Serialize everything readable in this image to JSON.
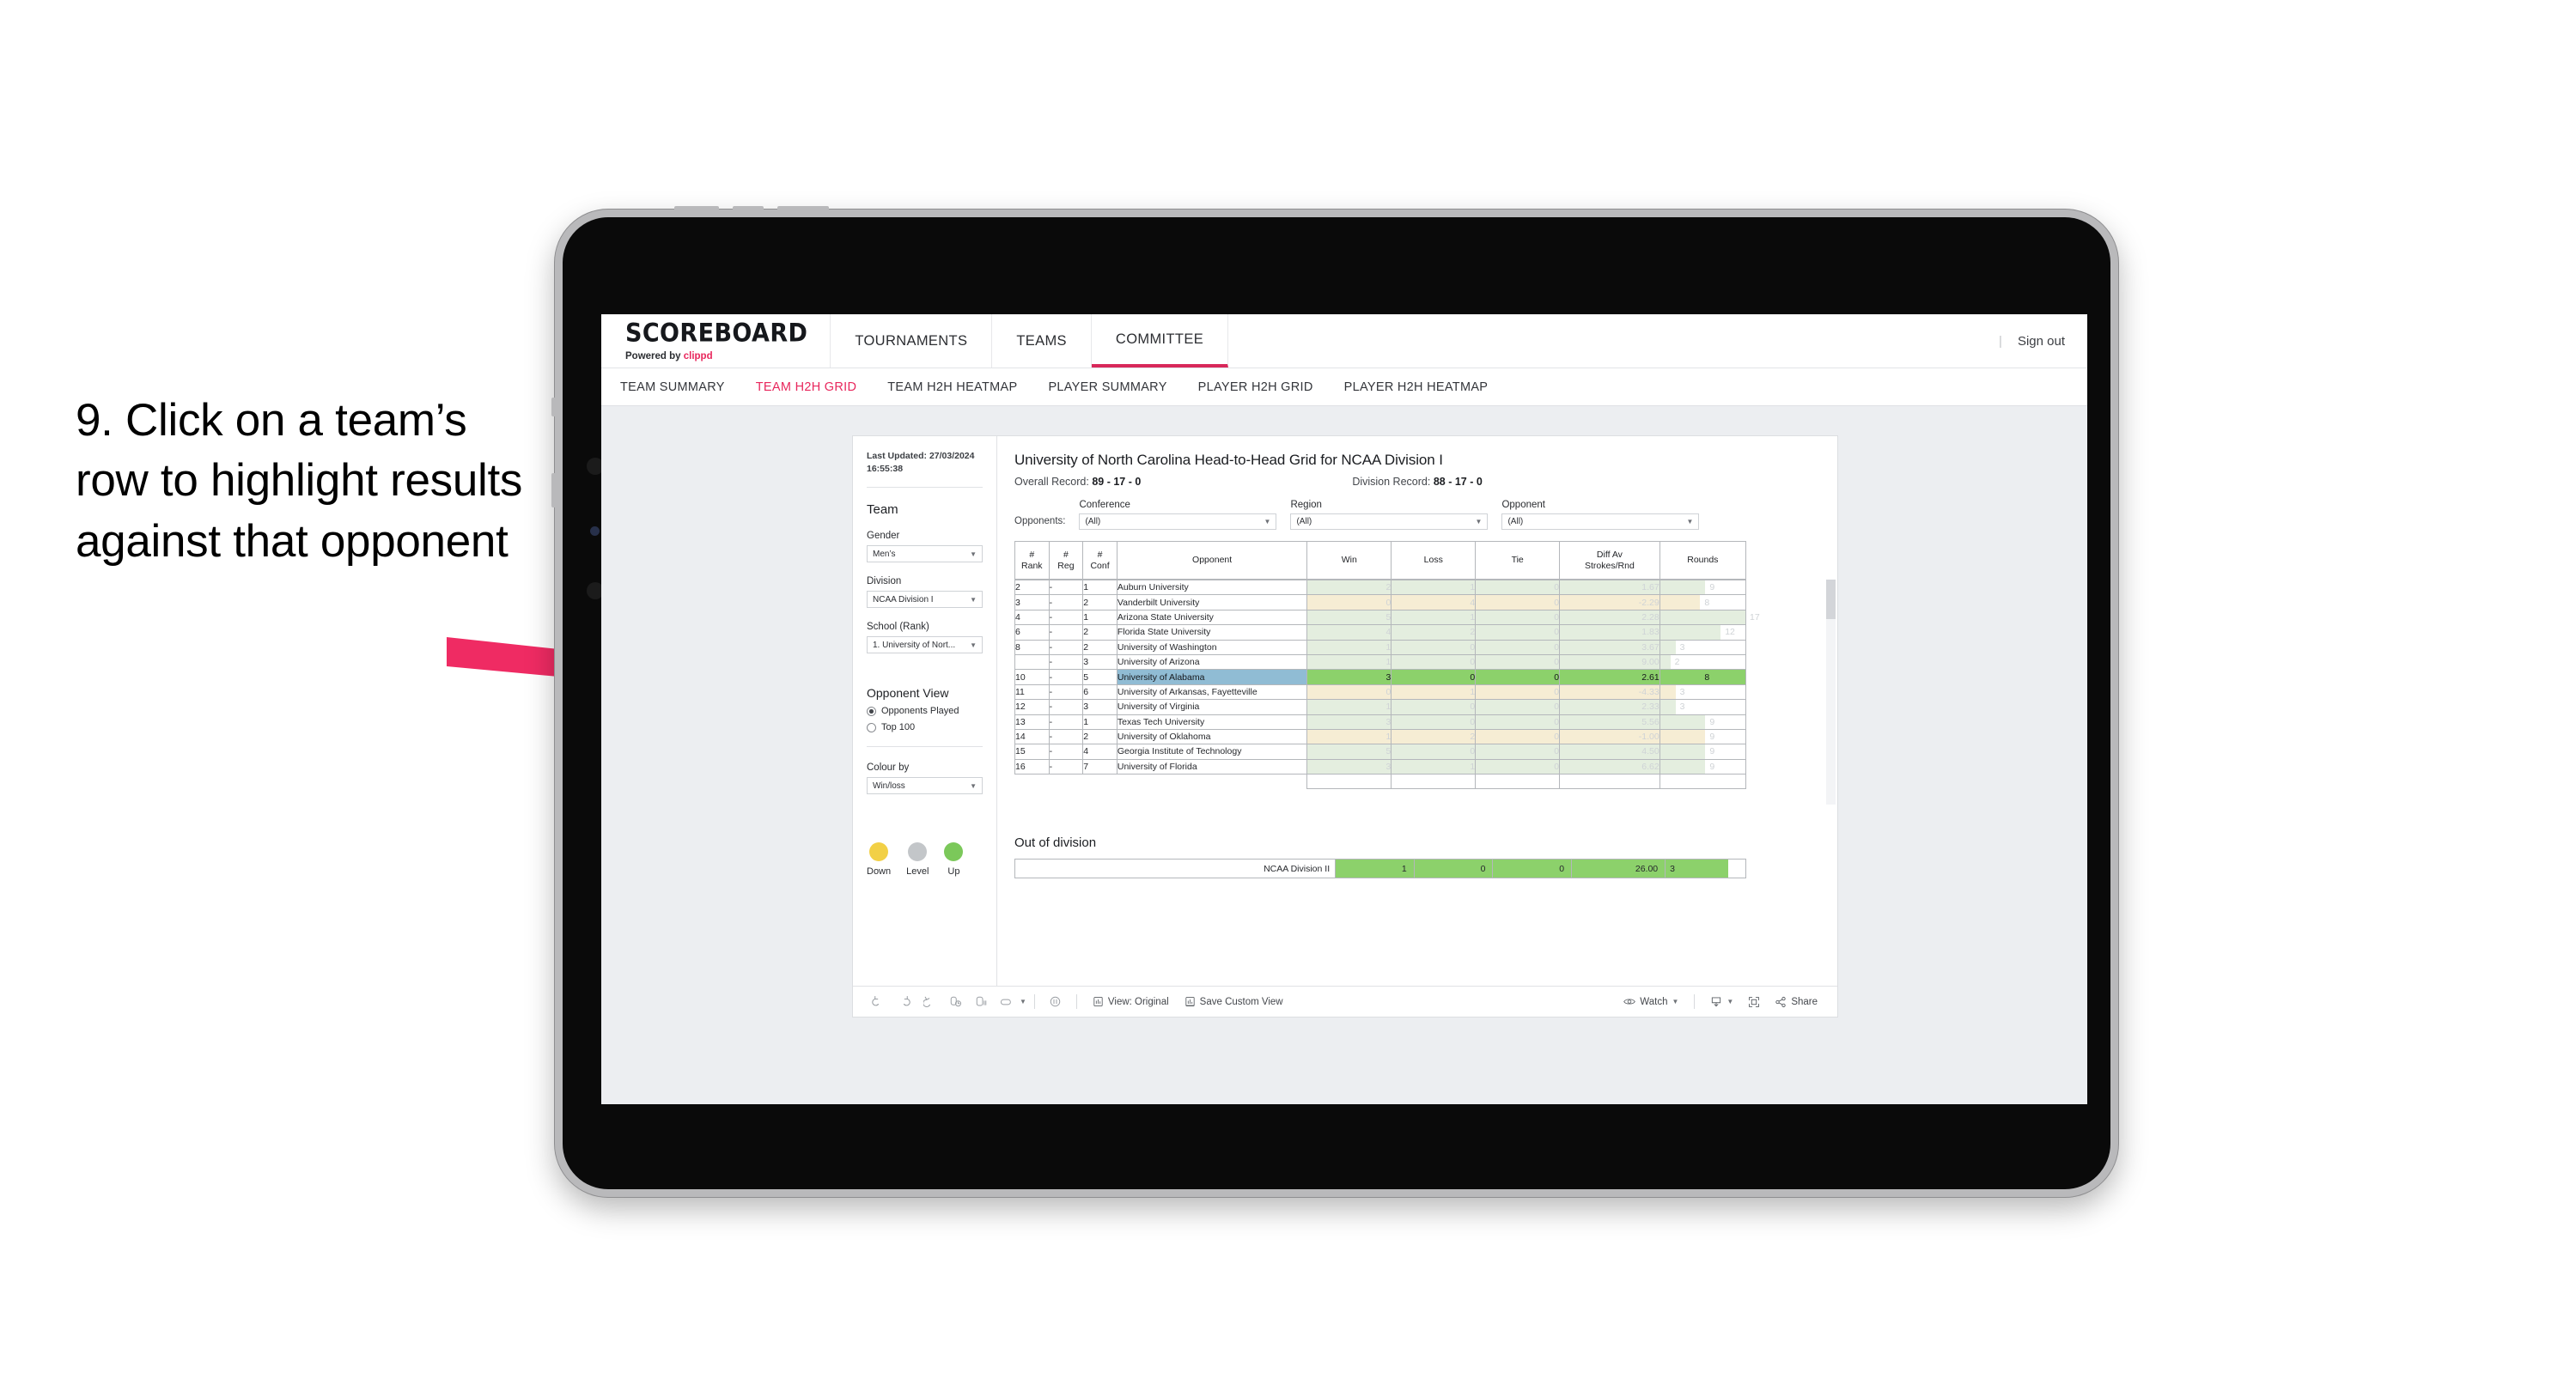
{
  "caption": "9. Click on a team’s row to highlight results against that opponent",
  "topnav": {
    "brand_title": "SCOREBOARD",
    "brand_sub_prefix": "Powered by ",
    "brand_sub_name": "clippd",
    "tabs": [
      {
        "label": "TOURNAMENTS",
        "active": false
      },
      {
        "label": "TEAMS",
        "active": false
      },
      {
        "label": "COMMITTEE",
        "active": true
      }
    ],
    "separator": "|",
    "signout": "Sign out"
  },
  "subnav": {
    "tabs": [
      {
        "label": "TEAM SUMMARY",
        "active": false
      },
      {
        "label": "TEAM H2H GRID",
        "active": true
      },
      {
        "label": "TEAM H2H HEATMAP",
        "active": false
      },
      {
        "label": "PLAYER SUMMARY",
        "active": false
      },
      {
        "label": "PLAYER H2H GRID",
        "active": false
      },
      {
        "label": "PLAYER H2H HEATMAP",
        "active": false
      }
    ]
  },
  "sidebar": {
    "last_updated_label": "Last Updated:",
    "last_updated_value": "27/03/2024 16:55:38",
    "team_heading": "Team",
    "gender_label": "Gender",
    "gender_value": "Men’s",
    "division_label": "Division",
    "division_value": "NCAA Division I",
    "school_label": "School (Rank)",
    "school_value": "1. University of Nort...",
    "opponent_view_heading": "Opponent View",
    "opponent_view_options": [
      {
        "label": "Opponents Played",
        "selected": true
      },
      {
        "label": "Top 100",
        "selected": false
      }
    ],
    "colour_by_label": "Colour by",
    "colour_by_value": "Win/loss",
    "legend": [
      {
        "label": "Down",
        "color": "#f2d046"
      },
      {
        "label": "Level",
        "color": "#c3c6c9"
      },
      {
        "label": "Up",
        "color": "#7bc85a"
      }
    ]
  },
  "main": {
    "title": "University of North Carolina Head-to-Head Grid for NCAA Division I",
    "overall_record_label": "Overall Record:",
    "overall_record_value": "89 - 17 - 0",
    "division_record_label": "Division Record:",
    "division_record_value": "88 - 17 - 0",
    "opponents_label": "Opponents:",
    "filters": [
      {
        "label": "Conference",
        "value": "(All)"
      },
      {
        "label": "Region",
        "value": "(All)"
      },
      {
        "label": "Opponent",
        "value": "(All)"
      }
    ],
    "columns": [
      "# Rank",
      "# Reg",
      "# Conf",
      "Opponent",
      "Win",
      "Loss",
      "Tie",
      "Diff Av Strokes/Rnd",
      "Rounds"
    ],
    "columns_split": [
      {
        "l1": "#",
        "l2": "Rank"
      },
      {
        "l1": "#",
        "l2": "Reg"
      },
      {
        "l1": "#",
        "l2": "Conf"
      },
      {
        "l1": "",
        "l2": "Opponent"
      },
      {
        "l1": "",
        "l2": "Win"
      },
      {
        "l1": "",
        "l2": "Loss"
      },
      {
        "l1": "",
        "l2": "Tie"
      },
      {
        "l1": "Diff Av",
        "l2": "Strokes/Rnd"
      },
      {
        "l1": "",
        "l2": "Rounds"
      }
    ],
    "rows": [
      {
        "rank": "2",
        "reg": "-",
        "conf": "1",
        "opponent": "Auburn University",
        "win": "2",
        "loss": "1",
        "tie": "0",
        "diff": "1.67",
        "rounds": "9",
        "tone": "up",
        "selected": false
      },
      {
        "rank": "3",
        "reg": "-",
        "conf": "2",
        "opponent": "Vanderbilt University",
        "win": "0",
        "loss": "4",
        "tie": "0",
        "diff": "-2.29",
        "rounds": "8",
        "tone": "down",
        "selected": false
      },
      {
        "rank": "4",
        "reg": "-",
        "conf": "1",
        "opponent": "Arizona State University",
        "win": "5",
        "loss": "1",
        "tie": "0",
        "diff": "2.28",
        "rounds": "17",
        "tone": "up",
        "selected": false
      },
      {
        "rank": "6",
        "reg": "-",
        "conf": "2",
        "opponent": "Florida State University",
        "win": "4",
        "loss": "2",
        "tie": "0",
        "diff": "1.83",
        "rounds": "12",
        "tone": "up",
        "selected": false
      },
      {
        "rank": "8",
        "reg": "-",
        "conf": "2",
        "opponent": "University of Washington",
        "win": "1",
        "loss": "0",
        "tie": "0",
        "diff": "3.67",
        "rounds": "3",
        "tone": "up",
        "selected": false
      },
      {
        "rank": "",
        "reg": "-",
        "conf": "3",
        "opponent": "University of Arizona",
        "win": "1",
        "loss": "0",
        "tie": "0",
        "diff": "9.00",
        "rounds": "2",
        "tone": "up",
        "selected": false
      },
      {
        "rank": "10",
        "reg": "-",
        "conf": "5",
        "opponent": "University of Alabama",
        "win": "3",
        "loss": "0",
        "tie": "0",
        "diff": "2.61",
        "rounds": "8",
        "tone": "up",
        "selected": true
      },
      {
        "rank": "11",
        "reg": "-",
        "conf": "6",
        "opponent": "University of Arkansas, Fayetteville",
        "win": "0",
        "loss": "1",
        "tie": "0",
        "diff": "-4.33",
        "rounds": "3",
        "tone": "down",
        "selected": false
      },
      {
        "rank": "12",
        "reg": "-",
        "conf": "3",
        "opponent": "University of Virginia",
        "win": "1",
        "loss": "0",
        "tie": "0",
        "diff": "2.33",
        "rounds": "3",
        "tone": "up",
        "selected": false
      },
      {
        "rank": "13",
        "reg": "-",
        "conf": "1",
        "opponent": "Texas Tech University",
        "win": "3",
        "loss": "0",
        "tie": "0",
        "diff": "5.56",
        "rounds": "9",
        "tone": "up",
        "selected": false
      },
      {
        "rank": "14",
        "reg": "-",
        "conf": "2",
        "opponent": "University of Oklahoma",
        "win": "1",
        "loss": "2",
        "tie": "0",
        "diff": "-1.00",
        "rounds": "9",
        "tone": "down",
        "selected": false
      },
      {
        "rank": "15",
        "reg": "-",
        "conf": "4",
        "opponent": "Georgia Institute of Technology",
        "win": "5",
        "loss": "0",
        "tie": "0",
        "diff": "4.50",
        "rounds": "9",
        "tone": "up",
        "selected": false
      },
      {
        "rank": "16",
        "reg": "-",
        "conf": "7",
        "opponent": "University of Florida",
        "win": "3",
        "loss": "1",
        "tie": "0",
        "diff": "6.62",
        "rounds": "9",
        "tone": "up",
        "selected": false
      }
    ],
    "out_of_division_heading": "Out of division",
    "out_of_division_row": {
      "label": "NCAA Division II",
      "win": "1",
      "loss": "0",
      "tie": "0",
      "diff": "26.00",
      "rounds": "3"
    }
  },
  "toolbar": {
    "view_label": "View: Original",
    "save_label": "Save Custom View",
    "watch_label": "Watch",
    "share_label": "Share"
  },
  "colors": {
    "accent_pink": "#e8265c",
    "arrow_pink": "#ef2b63",
    "up_green": "#7bc85a",
    "down_yellow": "#f2d046",
    "level_grey": "#c3c6c9",
    "select_blue": "#90bcd4",
    "select_green": "#8cd16b",
    "row_up_tint": "#e4eedf",
    "row_down_tint": "#f6edd4"
  }
}
